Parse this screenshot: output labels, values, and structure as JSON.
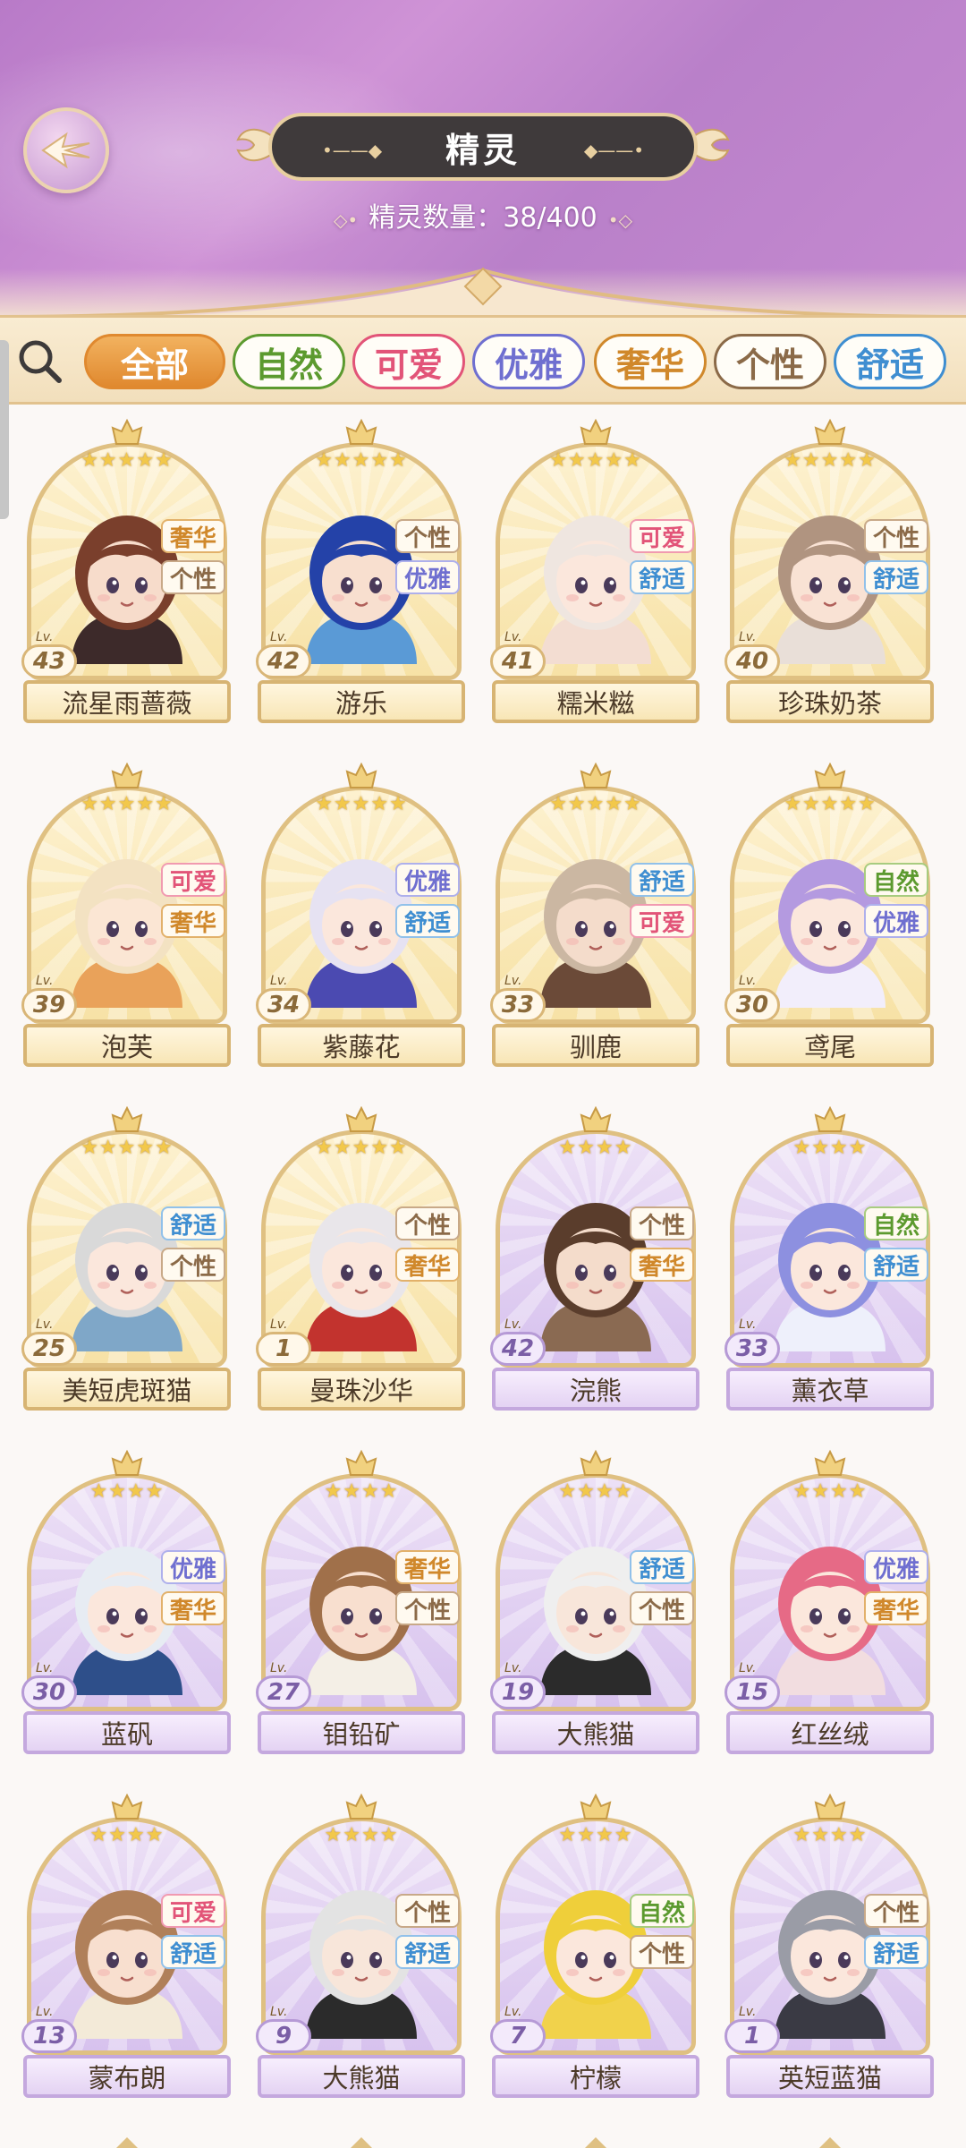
{
  "header": {
    "title": "精灵",
    "count_label": "精灵数量：",
    "count_value": "38/400"
  },
  "filters": [
    {
      "label": "全部",
      "selected": true,
      "color": "#e0892f"
    },
    {
      "label": "自然",
      "selected": false,
      "color": "#5c9a2f"
    },
    {
      "label": "可爱",
      "selected": false,
      "color": "#e25478"
    },
    {
      "label": "优雅",
      "selected": false,
      "color": "#6f6fd0"
    },
    {
      "label": "奢华",
      "selected": false,
      "color": "#d0882b"
    },
    {
      "label": "个性",
      "selected": false,
      "color": "#8b6a48"
    },
    {
      "label": "舒适",
      "selected": false,
      "color": "#3f8ed1"
    }
  ],
  "level_prefix": "Lv.",
  "spirits": [
    {
      "name": "流星雨蔷薇",
      "level": "43",
      "stars": "★★★★★",
      "tags": [
        "奢华",
        "个性"
      ],
      "frame": "gold",
      "hair": "#7a3f2c",
      "skin": "#f7dccb",
      "cloth": "#3d2a2a"
    },
    {
      "name": "游乐",
      "level": "42",
      "stars": "★★★★★",
      "tags": [
        "个性",
        "优雅"
      ],
      "frame": "gold",
      "hair": "#2442a8",
      "skin": "#f8dfcf",
      "cloth": "#5a9ad6"
    },
    {
      "name": "糯米糍",
      "level": "41",
      "stars": "★★★★★",
      "tags": [
        "可爱",
        "舒适"
      ],
      "frame": "gold",
      "hair": "#efe6e0",
      "skin": "#fbe7dc",
      "cloth": "#f3ddd2"
    },
    {
      "name": "珍珠奶茶",
      "level": "40",
      "stars": "★★★★★",
      "tags": [
        "个性",
        "舒适"
      ],
      "frame": "gold",
      "hair": "#b09480",
      "skin": "#f9e2d4",
      "cloth": "#e9dfd8"
    },
    {
      "name": "泡芙",
      "level": "39",
      "stars": "★★★★★",
      "tags": [
        "可爱",
        "奢华"
      ],
      "frame": "gold",
      "hair": "#f3e2c2",
      "skin": "#fbe6d4",
      "cloth": "#e9a25a"
    },
    {
      "name": "紫藤花",
      "level": "34",
      "stars": "★★★★★",
      "tags": [
        "优雅",
        "舒适"
      ],
      "frame": "gold",
      "hair": "#e6e2f2",
      "skin": "#fbe7dc",
      "cloth": "#4b4ab1"
    },
    {
      "name": "驯鹿",
      "level": "33",
      "stars": "★★★★★",
      "tags": [
        "舒适",
        "可爱"
      ],
      "frame": "gold",
      "hair": "#cbb7a2",
      "skin": "#f4dccb",
      "cloth": "#6b4a38"
    },
    {
      "name": "鸢尾",
      "level": "30",
      "stars": "★★★★★",
      "tags": [
        "自然",
        "优雅"
      ],
      "frame": "gold",
      "hair": "#b49ae0",
      "skin": "#fbe7dc",
      "cloth": "#f2eefb"
    },
    {
      "name": "美短虎斑猫",
      "level": "25",
      "stars": "★★★★★",
      "tags": [
        "舒适",
        "个性"
      ],
      "frame": "gold",
      "hair": "#d9d9d9",
      "skin": "#fbe7dc",
      "cloth": "#7fa7c8"
    },
    {
      "name": "曼珠沙华",
      "level": "1",
      "stars": "★★★★★",
      "tags": [
        "个性",
        "奢华"
      ],
      "frame": "gold",
      "hair": "#e9e6ea",
      "skin": "#fbe7dc",
      "cloth": "#c2332e"
    },
    {
      "name": "浣熊",
      "level": "42",
      "stars": "★★★★",
      "tags": [
        "个性",
        "奢华"
      ],
      "frame": "purple",
      "hair": "#5a3d2c",
      "skin": "#f4dccb",
      "cloth": "#8a6a52"
    },
    {
      "name": "薰衣草",
      "level": "33",
      "stars": "★★★★",
      "tags": [
        "自然",
        "舒适"
      ],
      "frame": "purple",
      "hair": "#8d90e0",
      "skin": "#fbe7dc",
      "cloth": "#eef0fb"
    },
    {
      "name": "蓝矾",
      "level": "30",
      "stars": "★★★★",
      "tags": [
        "优雅",
        "奢华"
      ],
      "frame": "purple",
      "hair": "#e7ecf3",
      "skin": "#fbe7dc",
      "cloth": "#2e4f8a"
    },
    {
      "name": "钼铅矿",
      "level": "27",
      "stars": "★★★★",
      "tags": [
        "奢华",
        "个性"
      ],
      "frame": "purple",
      "hair": "#a0704a",
      "skin": "#f8dfcf",
      "cloth": "#f4efe6"
    },
    {
      "name": "大熊猫",
      "level": "19",
      "stars": "★★★★",
      "tags": [
        "舒适",
        "个性"
      ],
      "frame": "purple",
      "hair": "#efefef",
      "skin": "#f8e6da",
      "cloth": "#2b2b2b"
    },
    {
      "name": "红丝绒",
      "level": "15",
      "stars": "★★★★",
      "tags": [
        "优雅",
        "奢华"
      ],
      "frame": "purple",
      "hair": "#e66a86",
      "skin": "#fbe7dc",
      "cloth": "#f2dde0"
    },
    {
      "name": "蒙布朗",
      "level": "13",
      "stars": "★★★★",
      "tags": [
        "可爱",
        "舒适"
      ],
      "frame": "purple",
      "hair": "#b0805a",
      "skin": "#f8dfcf",
      "cloth": "#f3ead8"
    },
    {
      "name": "大熊猫",
      "level": "9",
      "stars": "★★★★",
      "tags": [
        "个性",
        "舒适"
      ],
      "frame": "purple",
      "hair": "#e3e3e3",
      "skin": "#f8e6da",
      "cloth": "#2b2b2b"
    },
    {
      "name": "柠檬",
      "level": "7",
      "stars": "★★★★",
      "tags": [
        "自然",
        "个性"
      ],
      "frame": "purple",
      "hair": "#efcf3a",
      "skin": "#fbe7dc",
      "cloth": "#f1d24b"
    },
    {
      "name": "英短蓝猫",
      "level": "1",
      "stars": "★★★★",
      "tags": [
        "个性",
        "舒适"
      ],
      "frame": "purple",
      "hair": "#9a9ca6",
      "skin": "#fbe7dc",
      "cloth": "#3a3a44"
    }
  ]
}
